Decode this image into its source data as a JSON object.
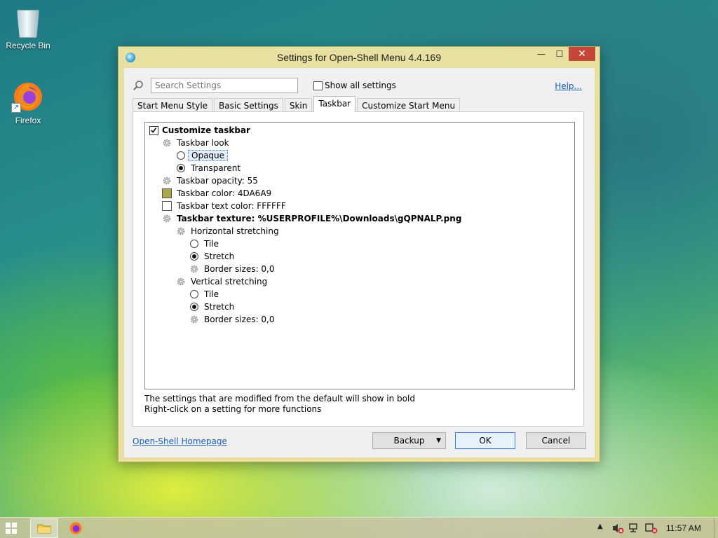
{
  "desktop": {
    "icons": [
      {
        "label": "Recycle Bin"
      },
      {
        "label": "Firefox"
      }
    ]
  },
  "window": {
    "title": "Settings for Open-Shell Menu 4.4.169",
    "controls": {
      "minimize": "—",
      "maximize": "☐",
      "close": "✕"
    },
    "search": {
      "placeholder": "Search Settings",
      "value": ""
    },
    "show_all_label": "Show all settings",
    "show_all_checked": false,
    "help_label": "Help...",
    "tabs": [
      {
        "label": "Start Menu Style",
        "active": false
      },
      {
        "label": "Basic Settings",
        "active": false
      },
      {
        "label": "Skin",
        "active": false
      },
      {
        "label": "Taskbar",
        "active": true
      },
      {
        "label": "Customize Start Menu",
        "active": false
      }
    ],
    "tree": {
      "customize_taskbar": "Customize taskbar",
      "taskbar_look": "Taskbar look",
      "opaque": "Opaque",
      "transparent": "Transparent",
      "taskbar_opacity": "Taskbar opacity: 55",
      "taskbar_color": "Taskbar color: 4DA6A9",
      "taskbar_color_swatch": "#a9a64d",
      "taskbar_text_color": "Taskbar text color: FFFFFF",
      "taskbar_text_color_swatch": "#ffffff",
      "taskbar_texture": "Taskbar texture: %USERPROFILE%\\Downloads\\gQPNALP.png",
      "horizontal_stretching": "Horizontal stretching",
      "h_tile": "Tile",
      "h_stretch": "Stretch",
      "h_border_sizes": "Border sizes: 0,0",
      "vertical_stretching": "Vertical stretching",
      "v_tile": "Tile",
      "v_stretch": "Stretch",
      "v_border_sizes": "Border sizes: 0,0"
    },
    "hint_line1": "The settings that are modified from the default will show in bold",
    "hint_line2": "Right-click on a setting for more functions",
    "homepage_label": "Open-Shell Homepage",
    "backup_label": "Backup",
    "ok_label": "OK",
    "cancel_label": "Cancel"
  },
  "taskbar": {
    "clock": "11:57 AM"
  }
}
